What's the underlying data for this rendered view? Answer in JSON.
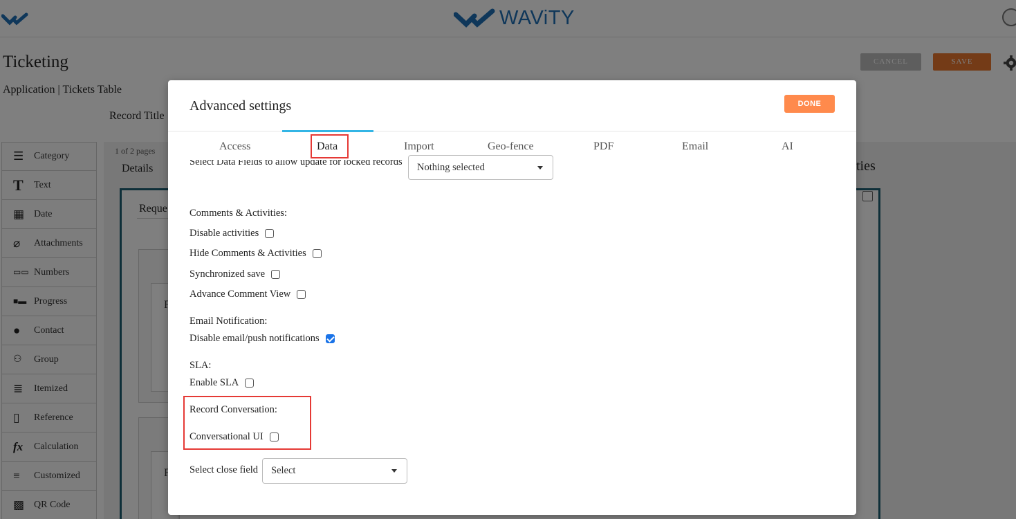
{
  "topbar": {
    "brand": "WAViTY"
  },
  "app": {
    "title": "Ticketing",
    "subtitle": "Application | Tickets Table",
    "record_title": "Record Title",
    "cancel_label": "CANCEL",
    "save_label": "SAVE",
    "pages_label": "1 of 2 pages",
    "details_tab": "Details",
    "request_label": "Reque",
    "field_letter_1": "F",
    "field_letter_2": "F",
    "properties_title": "ties"
  },
  "palette": [
    {
      "label": "Category",
      "icon": "list-icon"
    },
    {
      "label": "Text",
      "icon": "text-icon"
    },
    {
      "label": "Date",
      "icon": "calendar-icon"
    },
    {
      "label": "Attachments",
      "icon": "paperclip-icon"
    },
    {
      "label": "Numbers",
      "icon": "numbers-icon"
    },
    {
      "label": "Progress",
      "icon": "progress-icon"
    },
    {
      "label": "Contact",
      "icon": "contact-icon"
    },
    {
      "label": "Group",
      "icon": "group-icon"
    },
    {
      "label": "Itemized",
      "icon": "itemized-icon"
    },
    {
      "label": "Reference",
      "icon": "document-icon"
    },
    {
      "label": "Calculation",
      "icon": "fx-icon"
    },
    {
      "label": "Customized",
      "icon": "menu-icon"
    },
    {
      "label": "QR Code",
      "icon": "qr-code-icon"
    }
  ],
  "modal": {
    "title": "Advanced settings",
    "done_label": "DONE",
    "tabs": [
      "Access",
      "Data",
      "Import",
      "Geo-fence",
      "PDF",
      "Email",
      "AI"
    ],
    "active_tab": "Data",
    "locked_fields_label": "Select Data Fields to allow update for locked records",
    "locked_fields_value": "Nothing selected",
    "comments_section": "Comments & Activities:",
    "disable_activities": "Disable activities",
    "hide_comments": "Hide Comments & Activities",
    "sync_save": "Synchronized save",
    "advance_comment": "Advance Comment View",
    "email_section": "Email Notification:",
    "disable_email": "Disable email/push notifications",
    "sla_section": "SLA:",
    "enable_sla": "Enable SLA",
    "record_conv_section": "Record Conversation:",
    "conversational_ui": "Conversational UI",
    "close_field_label": "Select close field",
    "close_field_value": "Select",
    "checked": {
      "disable_activities": false,
      "hide_comments": false,
      "sync_save": false,
      "advance_comment": false,
      "disable_email": true,
      "enable_sla": false,
      "conversational_ui": false
    }
  },
  "colors": {
    "accent": "#ff8a4c",
    "tab_indicator": "#33b5e5",
    "highlight": "#e53935",
    "brand": "#1f6fb5"
  }
}
